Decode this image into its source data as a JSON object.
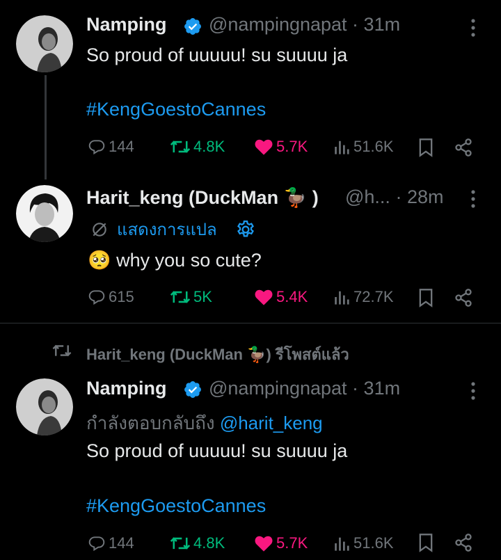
{
  "tweet1": {
    "name": "Namping",
    "handle": "@nampingnapat",
    "time": "31m",
    "text": "So proud of uuuuu! su suuuu ja",
    "hashtag": "#KengGoestoCannes",
    "replies": "144",
    "retweets": "4.8K",
    "likes": "5.7K",
    "views": "51.6K"
  },
  "tweet2": {
    "name": "Harit_keng (DuckMan",
    "name_emoji": "🦆",
    "name_close": ")",
    "handle": "@h...",
    "time": "28m",
    "translate_label": "แสดงการแปล",
    "text_emoji": "🥺",
    "text": "why you so cute?",
    "replies": "615",
    "retweets": "5K",
    "likes": "5.4K",
    "views": "72.7K"
  },
  "retweet_banner": {
    "name": "Harit_keng (DuckMan",
    "emoji": "🦆",
    "suffix": ") รีโพสต์แล้ว"
  },
  "tweet3": {
    "name": "Namping",
    "handle": "@nampingnapat",
    "time": "31m",
    "reply_prefix": "กำลังตอบกลับถึง",
    "reply_mention": "@harit_keng",
    "text": "So proud of uuuuu! su suuuu ja",
    "hashtag": "#KengGoestoCannes",
    "replies": "144",
    "retweets": "4.8K",
    "likes": "5.7K",
    "views": "51.6K"
  },
  "colors": {
    "background": "#000000",
    "text": "#e7e9ea",
    "secondary": "#71767b",
    "link": "#1d9bf0",
    "retweet": "#00ba7c",
    "like": "#f91880"
  }
}
